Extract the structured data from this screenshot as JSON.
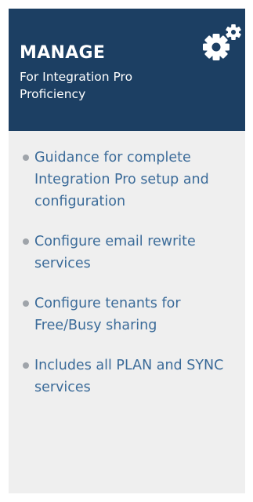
{
  "header": {
    "title": "MANAGE",
    "subtitle": "For Integration Pro Proficiency",
    "icon": "gears-icon",
    "background_color": "#1c3f63"
  },
  "features": {
    "items": [
      {
        "text": "Guidance for complete Integration Pro setup and configuration"
      },
      {
        "text": "Configure email rewrite services"
      },
      {
        "text": "Configure tenants for Free/Busy sharing"
      },
      {
        "text": "Includes all PLAN and SYNC services"
      }
    ],
    "text_color": "#3b6b99",
    "bullet_color": "#9fa4aa"
  }
}
